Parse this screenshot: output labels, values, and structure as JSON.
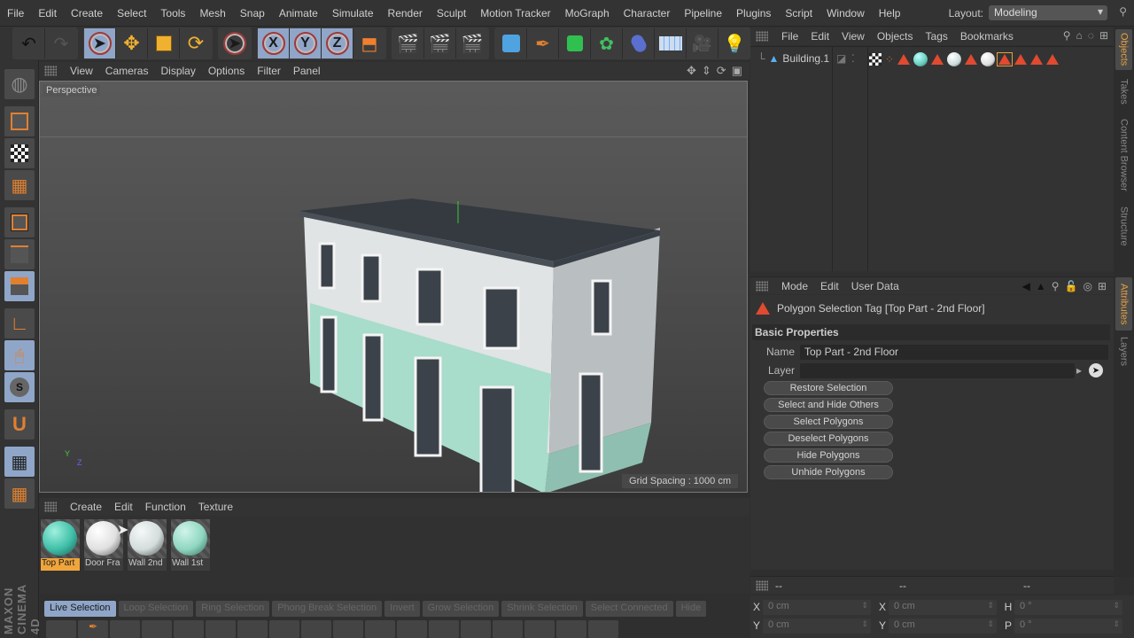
{
  "menubar": {
    "items": [
      "File",
      "Edit",
      "Create",
      "Select",
      "Tools",
      "Mesh",
      "Snap",
      "Animate",
      "Simulate",
      "Render",
      "Sculpt",
      "Motion Tracker",
      "MoGraph",
      "Character",
      "Pipeline",
      "Plugins",
      "Script",
      "Window",
      "Help"
    ],
    "layout_label": "Layout:",
    "layout_value": "Modeling"
  },
  "toolbar": {
    "undo": "undo-icon",
    "redo": "redo-icon",
    "tools": [
      "live-selection",
      "move",
      "scale",
      "rotate",
      "last-tool"
    ],
    "axes": [
      "X",
      "Y",
      "Z"
    ],
    "coord_system": "world-coordinates"
  },
  "viewport": {
    "menu": [
      "View",
      "Cameras",
      "Display",
      "Options",
      "Filter",
      "Panel"
    ],
    "camera_label": "Perspective",
    "grid_spacing": "Grid Spacing : 1000 cm",
    "axis_y": "Y",
    "axis_z": "Z"
  },
  "materials": {
    "menu": [
      "Create",
      "Edit",
      "Function",
      "Texture"
    ],
    "items": [
      {
        "label": "Top Part",
        "color": "#3fbfa8",
        "selected": true
      },
      {
        "label": "Door Fra",
        "color": "#e8e8e8",
        "selected": false
      },
      {
        "label": "Wall 2nd",
        "color": "#d4dcdc",
        "selected": false
      },
      {
        "label": "Wall 1st",
        "color": "#8fd6c0",
        "selected": false
      }
    ]
  },
  "selection_tools": [
    "Live Selection",
    "Loop Selection",
    "Ring Selection",
    "Phong Break Selection",
    "Invert",
    "Grow Selection",
    "Shrink Selection",
    "Select Connected",
    "Hide"
  ],
  "objects": {
    "menu": [
      "File",
      "Edit",
      "View",
      "Objects",
      "Tags",
      "Bookmarks"
    ],
    "rows": [
      {
        "name": "Building.1"
      }
    ]
  },
  "attributes": {
    "menu": [
      "Mode",
      "Edit",
      "User Data"
    ],
    "header": "Polygon Selection Tag [Top Part - 2nd Floor]",
    "section": "Basic Properties",
    "name_label": "Name",
    "name_value": "Top Part - 2nd Floor",
    "layer_label": "Layer",
    "layer_value": "",
    "buttons": [
      "Restore Selection",
      "Select and Hide Others",
      "Select Polygons",
      "Deselect Polygons",
      "Hide Polygons",
      "Unhide Polygons"
    ]
  },
  "coordinates": {
    "headers": [
      "--",
      "--",
      "--"
    ],
    "rows": [
      {
        "l1": "X",
        "v1": "0 cm",
        "l2": "X",
        "v2": "0 cm",
        "l3": "H",
        "v3": "0 °"
      },
      {
        "l1": "Y",
        "v1": "0 cm",
        "l2": "Y",
        "v2": "0 cm",
        "l3": "P",
        "v3": "0 °"
      }
    ]
  },
  "side_tabs": {
    "top": [
      "Objects",
      "Takes",
      "Content Browser",
      "Structure"
    ],
    "bottom": [
      "Attributes",
      "Layers"
    ]
  },
  "brand": "MAXON CINEMA 4D",
  "colors": {
    "accent": "#8fa6c9",
    "highlight": "#e8a040",
    "tag_red": "#e04a30"
  }
}
